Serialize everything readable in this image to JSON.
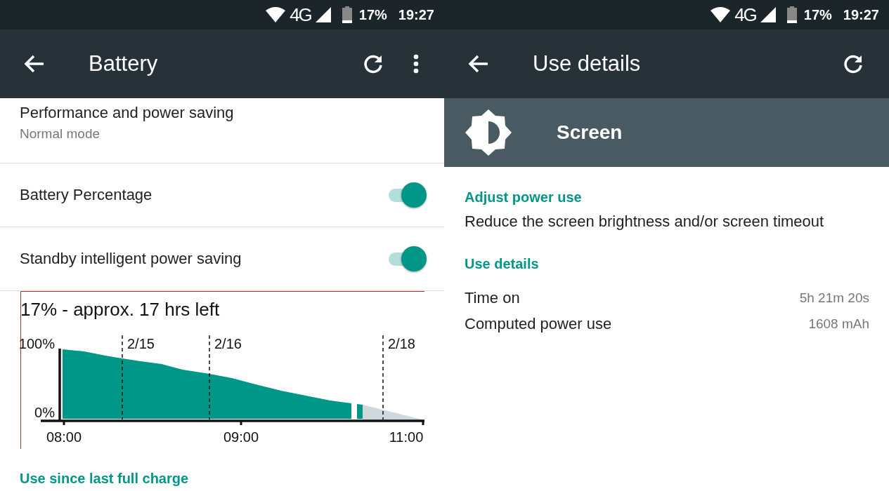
{
  "left": {
    "status_bar": {
      "network": "4G",
      "battery": "17%",
      "time": "19:27"
    },
    "toolbar": {
      "title": "Battery",
      "actions": [
        {
          "kind": "refresh"
        },
        {
          "kind": "more"
        }
      ]
    },
    "items": [
      {
        "kind": "text",
        "title": "Performance and power saving",
        "subtitle": "Normal mode"
      },
      {
        "kind": "switch",
        "title": "Battery Percentage",
        "on": true
      },
      {
        "kind": "switch",
        "title": "Standby intelligent power saving",
        "on": true
      }
    ],
    "graph": {
      "summary": "17% - approx. 17 hrs left",
      "y_labels": [
        "100%",
        "0%"
      ],
      "date_labels": [
        "2/15",
        "2/16",
        "2/18"
      ],
      "time_labels": [
        "08:00",
        "09:00",
        "11:00"
      ]
    },
    "section_header": "Use since last full charge"
  },
  "right": {
    "status_bar": {
      "network": "4G",
      "battery": "17%",
      "time": "19:27"
    },
    "toolbar": {
      "title": "Use details",
      "actions": [
        {
          "kind": "refresh"
        }
      ]
    },
    "header": {
      "title": "Screen"
    },
    "sections": [
      {
        "title": "Adjust power use",
        "text": "Reduce the screen brightness and/or screen timeout"
      },
      {
        "title": "Use details",
        "rows": [
          {
            "label": "Time on",
            "value": "5h 21m 20s"
          },
          {
            "label": "Computed power use",
            "value": "1608 mAh"
          }
        ]
      }
    ]
  }
}
